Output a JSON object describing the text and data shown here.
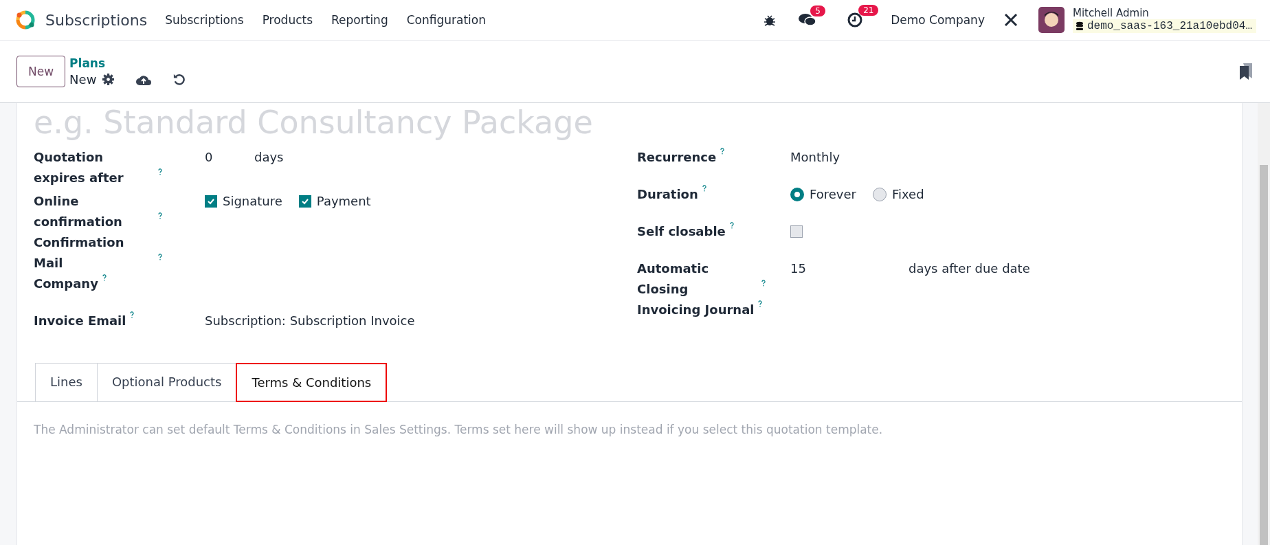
{
  "navbar": {
    "app_name": "Subscriptions",
    "menu": [
      "Subscriptions",
      "Products",
      "Reporting",
      "Configuration"
    ],
    "messages_count": "5",
    "activities_count": "21",
    "company": "Demo Company",
    "user_name": "Mitchell Admin",
    "database": "demo_saas-163_21a10ebd04…"
  },
  "control_panel": {
    "new_button": "New",
    "breadcrumb": "Plans",
    "record": "New"
  },
  "form": {
    "name_placeholder": "e.g. Standard Consultancy Package",
    "left_fields": [
      {
        "kind": "number",
        "label": "Quotation expires after",
        "value": "0",
        "unit": "days"
      },
      {
        "kind": "checkboxes",
        "label": "Online confirmation",
        "options": [
          {
            "label": "Signature",
            "checked": true
          },
          {
            "label": "Payment",
            "checked": true
          }
        ]
      },
      {
        "kind": "empty",
        "label": "Confirmation Mail"
      },
      {
        "kind": "empty",
        "label": "Company"
      },
      {
        "kind": "text",
        "label": "Invoice Email",
        "value": "Subscription: Subscription Invoice"
      }
    ],
    "right_fields": [
      {
        "kind": "text",
        "label": "Recurrence",
        "value": "Monthly"
      },
      {
        "kind": "radio",
        "label": "Duration",
        "options": [
          {
            "label": "Forever",
            "selected": true
          },
          {
            "label": "Fixed",
            "selected": false
          }
        ]
      },
      {
        "kind": "checkbox",
        "label": "Self closable",
        "checked": false
      },
      {
        "kind": "number",
        "label": "Automatic Closing",
        "value": "15",
        "unit": "days after due date"
      },
      {
        "kind": "empty",
        "label": "Invoicing Journal"
      }
    ],
    "tabs": [
      {
        "label": "Lines",
        "selected": false,
        "highlighted": false
      },
      {
        "label": "Optional Products",
        "selected": false,
        "highlighted": false
      },
      {
        "label": "Terms & Conditions",
        "selected": true,
        "highlighted": true
      }
    ],
    "note_placeholder": "The Administrator can set default Terms & Conditions in Sales Settings. Terms set here will show up instead if you select this quotation template."
  }
}
